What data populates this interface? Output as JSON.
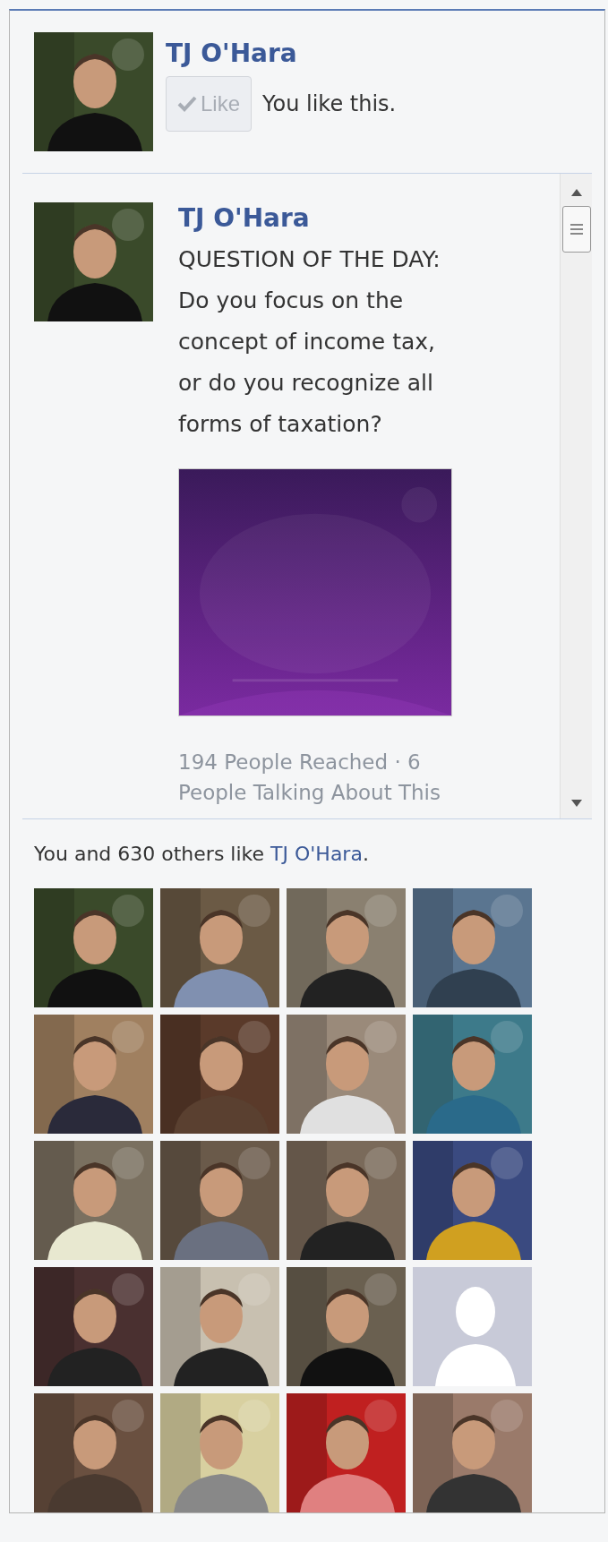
{
  "page": {
    "name": "TJ O'Hara",
    "like_button": {
      "label": "Like",
      "liked": true
    },
    "like_status": "You like this."
  },
  "post": {
    "author": "TJ O'Hara",
    "text": "QUESTION OF THE DAY: Do you focus on the concept of income tax, or do you recognize all forms of taxation?",
    "image": {
      "kind": "picture"
    },
    "stats": "194 People Reached · 6 People Talking About This"
  },
  "fans_summary": {
    "prefix": "You and 630 others like ",
    "link": "TJ O'Hara",
    "suffix": "."
  },
  "fans": [
    {
      "kind": "picture"
    },
    {
      "kind": "picture"
    },
    {
      "kind": "picture"
    },
    {
      "kind": "picture"
    },
    {
      "kind": "picture"
    },
    {
      "kind": "picture"
    },
    {
      "kind": "picture"
    },
    {
      "kind": "picture"
    },
    {
      "kind": "picture"
    },
    {
      "kind": "picture"
    },
    {
      "kind": "picture"
    },
    {
      "kind": "picture"
    },
    {
      "kind": "picture"
    },
    {
      "kind": "picture"
    },
    {
      "kind": "picture"
    },
    {
      "kind": "silhouette"
    },
    {
      "kind": "picture"
    },
    {
      "kind": "picture"
    },
    {
      "kind": "picture"
    },
    {
      "kind": "picture"
    }
  ]
}
